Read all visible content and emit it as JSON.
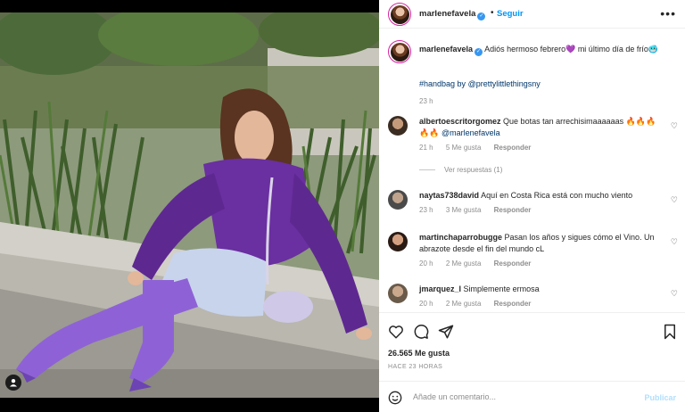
{
  "post": {
    "username": "marlenefavela",
    "follow_label": "Seguir",
    "caption": {
      "username": "marlenefavela",
      "text": "Adiós hermoso febrero💜 mi último día de frío🥶",
      "tags_prefix": "#handbag by ",
      "tags_mention": "@prettylittlethingsny",
      "time": "23 h"
    },
    "comments": [
      {
        "username": "albertoescritorgomez",
        "text": "Que botas tan arrechisimaaaaaas 🔥🔥🔥🔥🔥",
        "mention": "@marlenefavela",
        "time": "21 h",
        "likes": "5 Me gusta",
        "reply": "Responder"
      },
      {
        "username": "naytas738david",
        "text": "Aquí en Costa Rica está con mucho viento",
        "mention": "",
        "time": "23 h",
        "likes": "3 Me gusta",
        "reply": "Responder"
      },
      {
        "username": "martinchaparrobugge",
        "text": "Pasan los años y sigues cómo el Vino. Un abrazote desde el fin del mundo cL",
        "mention": "",
        "time": "20 h",
        "likes": "2 Me gusta",
        "reply": "Responder"
      },
      {
        "username": "jmarquez_l",
        "text": "Simplemente ermosa",
        "mention": "",
        "time": "20 h",
        "likes": "2 Me gusta",
        "reply": "Responder"
      }
    ],
    "view_replies": "Ver respuestas (1)",
    "likes_count": "26.565 Me gusta",
    "posted_ago": "HACE 23 HORAS",
    "add_comment_placeholder": "Añade un comentario...",
    "publish_label": "Publicar"
  },
  "colors": {
    "accent": "#0095f6",
    "publish_disabled": "#b2dffc",
    "verified": "#3897f0",
    "sweater": "#6a2fa0",
    "boots": "#8e62d6"
  },
  "icons": [
    "user-tag-icon",
    "verified-icon",
    "more-icon",
    "heart-icon",
    "comment-icon",
    "share-icon",
    "bookmark-icon",
    "emoji-icon"
  ]
}
